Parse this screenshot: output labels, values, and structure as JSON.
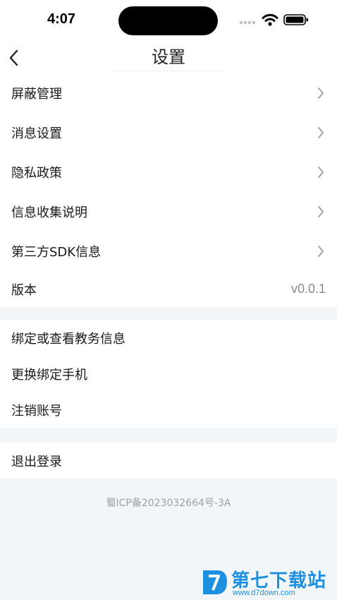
{
  "status_bar": {
    "time": "4:07"
  },
  "nav": {
    "title": "设置"
  },
  "settings_group": [
    {
      "label": "屏蔽管理"
    },
    {
      "label": "消息设置"
    },
    {
      "label": "隐私政策"
    },
    {
      "label": "信息收集说明"
    },
    {
      "label": "第三方SDK信息"
    }
  ],
  "version": {
    "label": "版本",
    "value": "v0.0.1"
  },
  "account_group": [
    {
      "label": "绑定或查看教务信息"
    },
    {
      "label": "更换绑定手机"
    },
    {
      "label": "注销账号"
    }
  ],
  "logout": {
    "label": "退出登录"
  },
  "footer": {
    "icp": "蜀ICP备2023032664号-3A"
  },
  "watermark": {
    "title": "第七下载站",
    "url": "www.d7down.com"
  },
  "colors": {
    "background": "#f3f6f8",
    "card": "#ffffff",
    "accent": "#1f8fe0"
  }
}
